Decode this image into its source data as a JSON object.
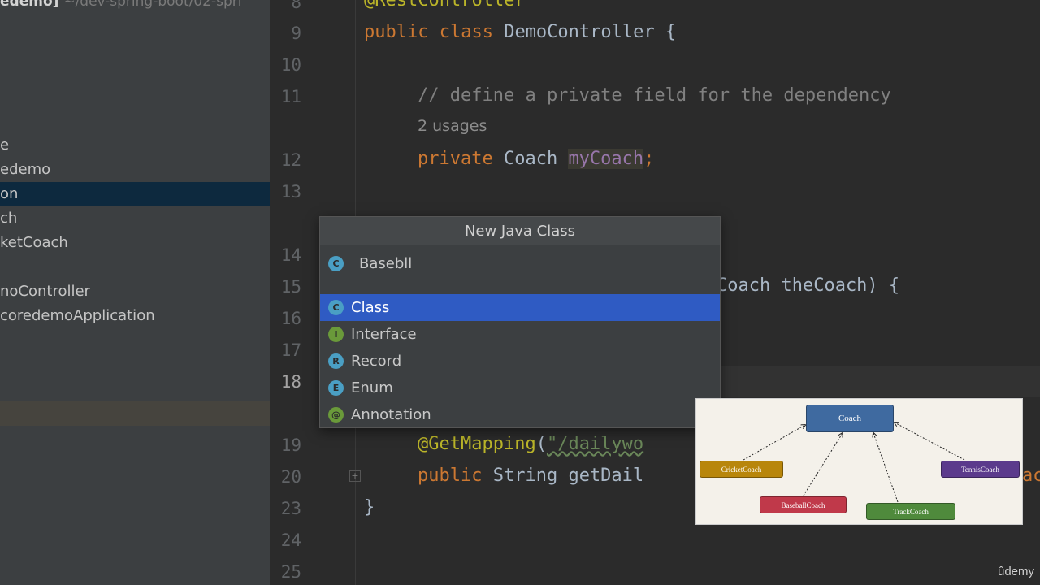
{
  "project_header": {
    "name": "edemo]",
    "path": "~/dev-spring-boot/02-spri"
  },
  "sidebar": {
    "items": [
      {
        "label": "e"
      },
      {
        "label": "edemo"
      },
      {
        "label": "on"
      },
      {
        "label": "ch"
      },
      {
        "label": "ketCoach"
      },
      {
        "label": "noController"
      },
      {
        "label": "coredemoApplication"
      }
    ]
  },
  "editor": {
    "line_numbers": [
      "8",
      "9",
      "10",
      "11",
      "12",
      "13",
      "14",
      "15",
      "16",
      "17",
      "18",
      "19",
      "20",
      "23",
      "24",
      "25"
    ],
    "usages_hint": "2 usages",
    "code": {
      "l8_ann": "@RestController",
      "l9_kw": "public class",
      "l9_rest": " DemoController {",
      "l11_cmt": "// define a private field for the dependency",
      "l12_kw": "private",
      "l12_type": " Coach ",
      "l12_field": "myCoach",
      "l12_semi": ";",
      "l15_rest": "Coach theCoach) {",
      "l19_ann": "@GetMapping",
      "l19_paren": "(",
      "l19_str": "\"/dailywo",
      "l20_kw": "public",
      "l20_rest": " String getDail",
      "l20_tail": "ac",
      "l23_brace": "}"
    }
  },
  "popup": {
    "title": "New Java Class",
    "name_value": "Basebll",
    "kinds": [
      {
        "label": "Class",
        "icon": "C",
        "color": "#4a9fc4",
        "icon_name": "class-icon"
      },
      {
        "label": "Interface",
        "icon": "I",
        "color": "#6a9a3a",
        "icon_name": "interface-icon"
      },
      {
        "label": "Record",
        "icon": "R",
        "color": "#4a9fc4",
        "icon_name": "record-icon"
      },
      {
        "label": "Enum",
        "icon": "E",
        "color": "#4a9fc4",
        "icon_name": "enum-icon"
      },
      {
        "label": "Annotation",
        "icon": "@",
        "color": "#6a9a3a",
        "icon_name": "annotation-icon"
      }
    ],
    "selected": "Class"
  },
  "diagram": {
    "nodes": {
      "coach": "Coach",
      "cricket": "CricketCoach",
      "tennis": "TennisCoach",
      "baseball": "BaseballCoach",
      "track": "TrackCoach"
    },
    "colors": {
      "coach": "#3f6aa0",
      "cricket": "#b8860b",
      "tennis": "#5b3a8c",
      "baseball": "#c0394a",
      "track": "#4f8a3c"
    }
  },
  "watermark": "ûdemy"
}
